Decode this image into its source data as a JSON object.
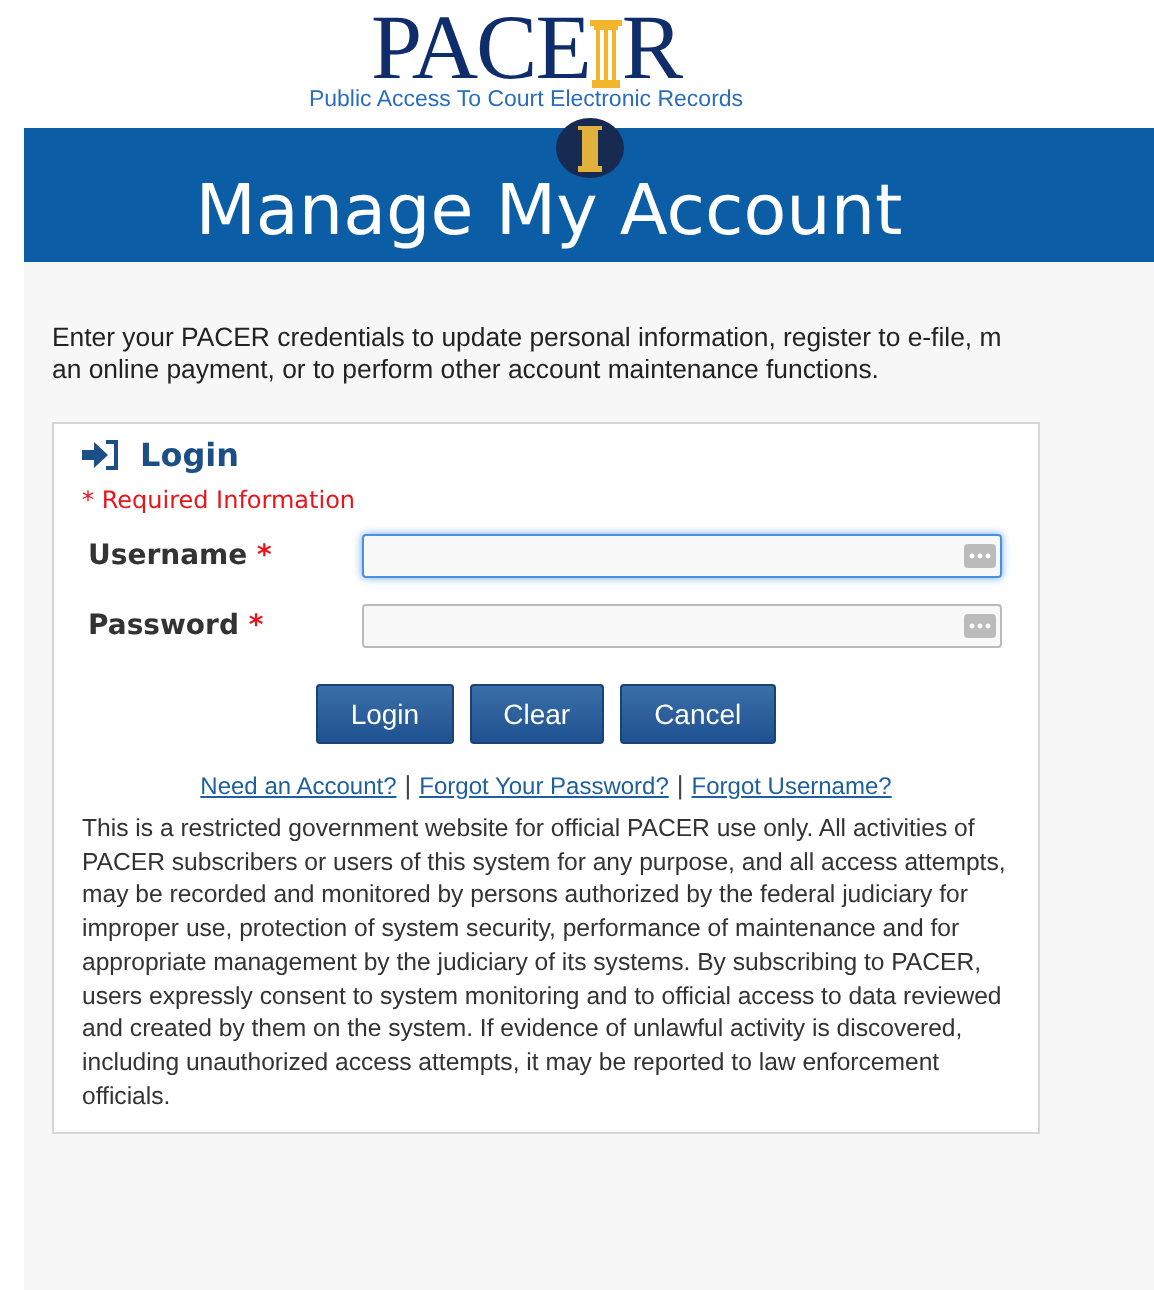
{
  "logo": {
    "text_before": "PACE",
    "text_after": "R",
    "tagline": "Public Access To Court Electronic Records"
  },
  "banner": {
    "title": "Manage My Account"
  },
  "intro": [
    "Enter your PACER credentials to update personal information, register to e-file, m",
    "an online payment, or to perform other account maintenance functions."
  ],
  "login": {
    "title": "Login",
    "required_note": "Required Information",
    "required_mark": "*",
    "fields": [
      {
        "label": "Username",
        "focused": true
      },
      {
        "label": "Password",
        "focused": false
      }
    ],
    "buttons": [
      "Login",
      "Clear",
      "Cancel"
    ],
    "links": [
      "Need an Account?",
      "Forgot Your Password?",
      "Forgot Username?"
    ],
    "separator": "|",
    "notice": "This is a restricted government website for official PACER use only. All activities of PACER subscribers or users of this system for any purpose, and all access attempts, may be recorded and monitored by persons authorized by the federal judiciary for improper use, protection of system security, performance of maintenance and for appropriate management by the judiciary of its systems. By subscribing to PACER, users expressly consent to system monitoring and to official access to data reviewed and created by them on the system. If evidence of unlawful activity is discovered, including unauthorized access attempts, it may be reported to law enforcement officials."
  }
}
